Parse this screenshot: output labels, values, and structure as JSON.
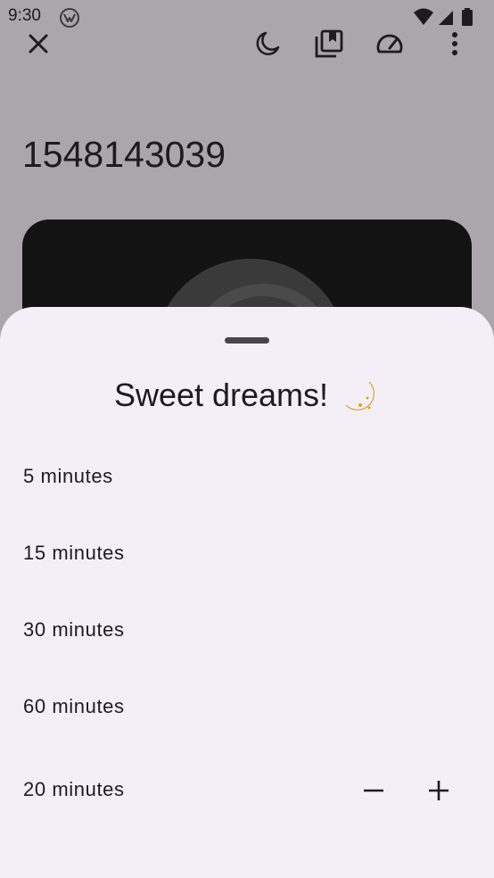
{
  "status_bar": {
    "time": "9:30",
    "icons": [
      "vpn-logo-icon",
      "wifi-icon",
      "signal-icon",
      "battery-icon"
    ]
  },
  "toolbar": {
    "icons": [
      "close-icon",
      "sleep-timer-moon-icon",
      "playlist-add-icon",
      "playback-speed-icon",
      "more-vert-icon"
    ]
  },
  "page": {
    "title": "1548143039"
  },
  "sheet": {
    "title": "Sweet dreams!",
    "title_emoji": "crescent-moon-icon",
    "options": [
      {
        "label": "5 minutes"
      },
      {
        "label": "15 minutes"
      },
      {
        "label": "30 minutes"
      },
      {
        "label": "60 minutes"
      }
    ],
    "custom": {
      "label": "20 minutes",
      "decrement_icon": "minus-icon",
      "increment_icon": "plus-icon"
    }
  },
  "colors": {
    "scrim_background": "#aaa6ab",
    "sheet_background": "#f4eff6",
    "text": "#1d1b20",
    "artwork": "#141314"
  }
}
